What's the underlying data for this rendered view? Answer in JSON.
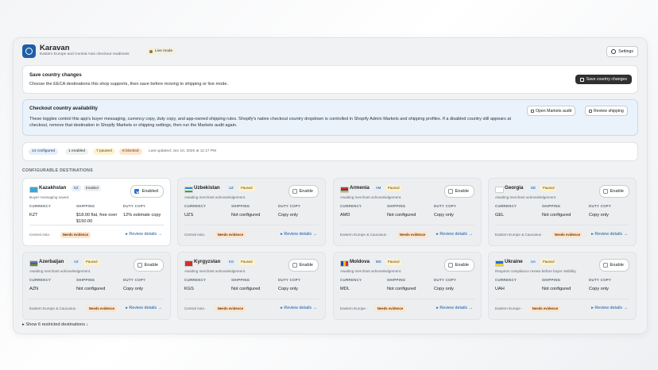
{
  "header": {
    "title": "Karavan",
    "subtitle": "Eastern Europe and Central Asia checkout readiness",
    "live_badge": "Live mode",
    "settings_label": "Settings"
  },
  "save_card": {
    "title": "Save country changes",
    "description": "Choose the EECA destinations this shop supports, then save before moving to shipping or live mode.",
    "button_label": "Save country changes"
  },
  "info_card": {
    "title": "Checkout country availability",
    "description": "These toggles control this app's buyer messaging, currency copy, duty copy, and app-owned shipping rules. Shopify's native checkout country dropdown is controlled in Shopify Admin Markets and shipping profiles. If a disabled country still appears at checkout, remove that destination in Shopify Markets or shipping settings, then run the Markets audit again.",
    "open_markets_label": "Open Markets audit",
    "review_shipping_label": "Review shipping"
  },
  "summary": {
    "configured": "14 configured",
    "enabled": "1 enabled",
    "paused": "7 paused",
    "blocked": "6 blocked",
    "last_updated": "Last updated: Jun 10, 2026 at 11:17 PM"
  },
  "section_label": "CONFIGURABLE DESTINATIONS",
  "labels": {
    "currency": "CURRENCY",
    "shipping": "SHIPPING",
    "duty": "DUTY COPY",
    "review": "Review details",
    "needs_evidence": "Needs evidence"
  },
  "destinations": [
    {
      "name": "Kazakhstan",
      "code": "KZ",
      "status": "Enabled",
      "note": "Buyer messaging saved.",
      "toggle": "Enabled",
      "currency": "KZT",
      "shipping": "$18.00 flat, free over $150.00",
      "duty": "12% estimate copy",
      "region": "Central Asia ·"
    },
    {
      "name": "Uzbekistan",
      "code": "UZ",
      "status": "Paused",
      "note": "Awaiting merchant acknowledgement.",
      "toggle": "Enable",
      "currency": "UZS",
      "shipping": "Not configured",
      "duty": "Copy only",
      "region": "Central Asia ·"
    },
    {
      "name": "Armenia",
      "code": "AM",
      "status": "Paused",
      "note": "Awaiting merchant acknowledgement.",
      "toggle": "Enable",
      "currency": "AMD",
      "shipping": "Not configured",
      "duty": "Copy only",
      "region": "Eastern Europe & Caucasus ·"
    },
    {
      "name": "Georgia",
      "code": "GE",
      "status": "Paused",
      "note": "Awaiting merchant acknowledgement.",
      "toggle": "Enable",
      "currency": "GEL",
      "shipping": "Not configured",
      "duty": "Copy only",
      "region": "Eastern Europe & Caucasus ·"
    },
    {
      "name": "Azerbaijan",
      "code": "AZ",
      "status": "Paused",
      "note": "Awaiting merchant acknowledgement.",
      "toggle": "Enable",
      "currency": "AZN",
      "shipping": "Not configured",
      "duty": "Copy only",
      "region": "Eastern Europe & Caucasus ·"
    },
    {
      "name": "Kyrgyzstan",
      "code": "KG",
      "status": "Paused",
      "note": "Awaiting merchant acknowledgement.",
      "toggle": "Enable",
      "currency": "KGS",
      "shipping": "Not configured",
      "duty": "Copy only",
      "region": "Central Asia ·"
    },
    {
      "name": "Moldova",
      "code": "MD",
      "status": "Paused",
      "note": "Awaiting merchant acknowledgement.",
      "toggle": "Enable",
      "currency": "MDL",
      "shipping": "Not configured",
      "duty": "Copy only",
      "region": "Eastern Europe ·"
    },
    {
      "name": "Ukraine",
      "code": "UA",
      "status": "Paused",
      "note": "Requires compliance review before buyer visibility.",
      "toggle": "Enable",
      "currency": "UAH",
      "shipping": "Not configured",
      "duty": "Copy only",
      "region": "Eastern Europe ·"
    }
  ],
  "show_restricted": "▸ Show 6 restricted destinations ↓"
}
